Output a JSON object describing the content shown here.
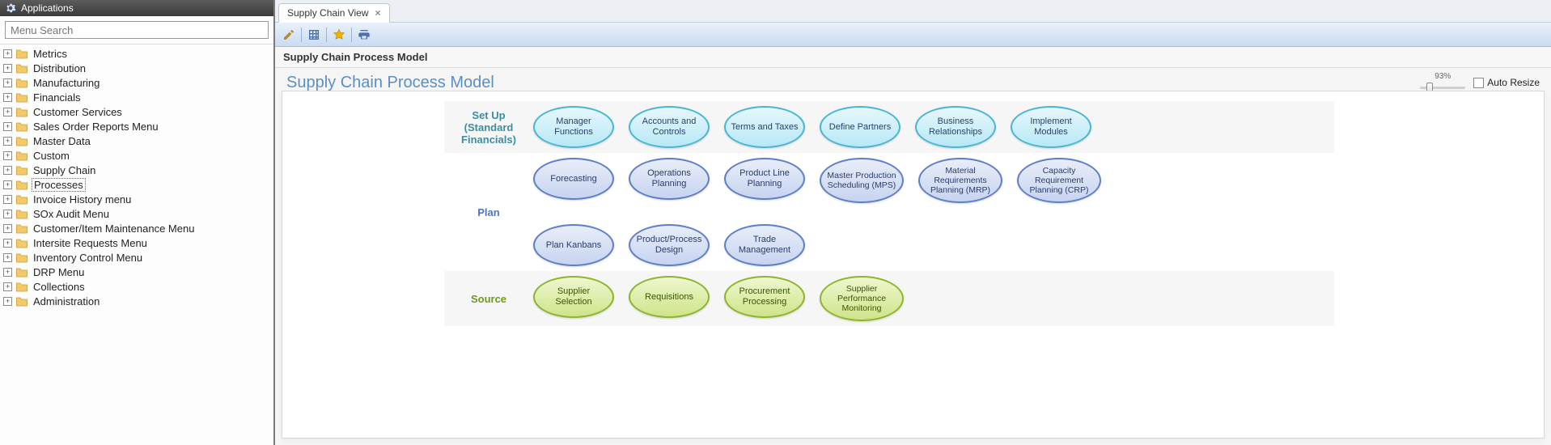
{
  "sidebar": {
    "title": "Applications",
    "search_placeholder": "Menu Search",
    "items": [
      {
        "label": "Metrics",
        "selected": false
      },
      {
        "label": "Distribution",
        "selected": false
      },
      {
        "label": "Manufacturing",
        "selected": false
      },
      {
        "label": "Financials",
        "selected": false
      },
      {
        "label": "Customer Services",
        "selected": false
      },
      {
        "label": "Sales Order Reports Menu",
        "selected": false
      },
      {
        "label": "Master Data",
        "selected": false
      },
      {
        "label": "Custom",
        "selected": false
      },
      {
        "label": "Supply Chain",
        "selected": false
      },
      {
        "label": "Processes",
        "selected": true
      },
      {
        "label": "Invoice History menu",
        "selected": false
      },
      {
        "label": "SOx Audit Menu",
        "selected": false
      },
      {
        "label": "Customer/Item Maintenance Menu",
        "selected": false
      },
      {
        "label": "Intersite Requests Menu",
        "selected": false
      },
      {
        "label": "Inventory Control Menu",
        "selected": false
      },
      {
        "label": "DRP Menu",
        "selected": false
      },
      {
        "label": "Collections",
        "selected": false
      },
      {
        "label": "Administration",
        "selected": false
      }
    ]
  },
  "tabs": [
    {
      "label": "Supply Chain View",
      "active": true
    }
  ],
  "toolbar": {
    "actions": [
      "edit",
      "grid",
      "favorite",
      "print"
    ]
  },
  "breadcrumb": "Supply Chain Process Model",
  "heading": "Supply Chain Process Model",
  "zoom": {
    "percent_label": "93%",
    "auto_resize_label": "Auto Resize",
    "auto_resize_checked": false
  },
  "diagram": {
    "rows": [
      {
        "id": "setup",
        "label_lines": [
          "Set Up",
          "(Standard",
          "Financials)"
        ],
        "color": "teal",
        "stripe": true,
        "nodes": [
          "Manager Functions",
          "Accounts and Controls",
          "Terms and Taxes",
          "Define Partners",
          "Business Relationships",
          "Implement Modules"
        ]
      },
      {
        "id": "plan",
        "label_lines": [
          "Plan"
        ],
        "color": "blue",
        "stripe": false,
        "nodes": [
          "Forecasting",
          "Operations Planning",
          "Product Line Planning",
          "Master Production Scheduling (MPS)",
          "Material Requirements Planning (MRP)",
          "Capacity Requirement Planning (CRP)"
        ],
        "nodes2": [
          "Plan Kanbans",
          "Product/Process Design",
          "Trade Management"
        ]
      },
      {
        "id": "source",
        "label_lines": [
          "Source"
        ],
        "color": "green",
        "stripe": true,
        "nodes": [
          "Supplier Selection",
          "Requisitions",
          "Procurement Processing",
          "Supplier Performance Monitoring"
        ]
      }
    ]
  }
}
